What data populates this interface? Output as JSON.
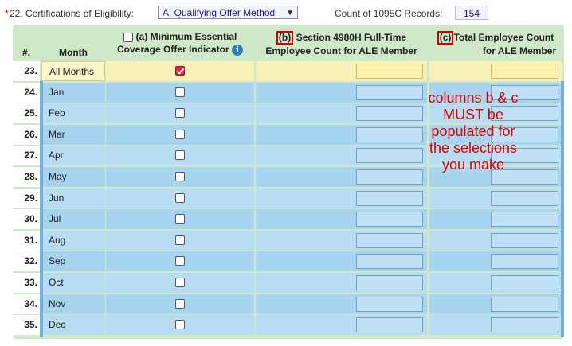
{
  "topbar": {
    "required_marker": "*",
    "label": "22. Certifications of Eligibility:",
    "select_value": "A. Qualifying Offer Method",
    "count_label": "Count of 1095C Records:",
    "count_value": "154"
  },
  "table": {
    "headers": {
      "num": "#.",
      "month": "Month",
      "col_a": "(a) Minimum Essential",
      "col_a_line2": "Coverage Offer Indicator",
      "col_b_marker": "(b)",
      "col_b": "Section 4980H Full-Time",
      "col_b_line2": "Employee Count for ALE Member",
      "col_c_marker": "(c)",
      "col_c": "Total Employee Count",
      "col_c_line2": "for ALE Member"
    },
    "rows": [
      {
        "num": "23.",
        "month": "All Months",
        "checked": true
      },
      {
        "num": "24.",
        "month": "Jan",
        "checked": false
      },
      {
        "num": "25.",
        "month": "Feb",
        "checked": false
      },
      {
        "num": "26.",
        "month": "Mar",
        "checked": false
      },
      {
        "num": "27.",
        "month": "Apr",
        "checked": false
      },
      {
        "num": "28.",
        "month": "May",
        "checked": false
      },
      {
        "num": "29.",
        "month": "Jun",
        "checked": false
      },
      {
        "num": "30.",
        "month": "Jul",
        "checked": false
      },
      {
        "num": "31.",
        "month": "Aug",
        "checked": false
      },
      {
        "num": "32.",
        "month": "Sep",
        "checked": false
      },
      {
        "num": "33.",
        "month": "Oct",
        "checked": false
      },
      {
        "num": "34.",
        "month": "Nov",
        "checked": false
      },
      {
        "num": "35.",
        "month": "Dec",
        "checked": false
      }
    ]
  },
  "annotation": {
    "lines": [
      "columns b & c",
      "MUST be",
      "populated for",
      "the selections",
      "you make"
    ]
  },
  "icons": {
    "info": "info-icon",
    "dropdown": "chevron-down-icon"
  },
  "colors": {
    "header_bg": "#cfe8c7",
    "row_bg": "#a7d4ee",
    "selected_row_bg": "#f7f0b8",
    "annotation": "#e00000",
    "checkbox_checked": "#d8254b"
  }
}
